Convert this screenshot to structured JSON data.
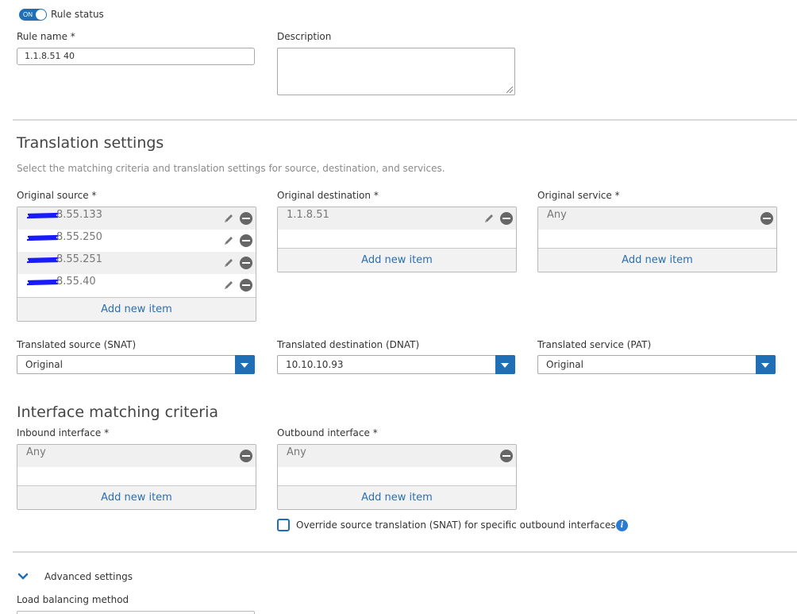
{
  "rule_status": {
    "toggle_text": "ON",
    "label": "Rule status"
  },
  "rule_name": {
    "label": "Rule name *",
    "value": "1.1.8.51 40"
  },
  "description": {
    "label": "Description",
    "value": ""
  },
  "translation": {
    "title": "Translation settings",
    "desc": "Select the matching criteria and translation settings for source, destination, and services.",
    "original_source": {
      "label": "Original source *",
      "items": [
        "8.55.133",
        "8.55.250",
        "8.55.251",
        "8.55.40"
      ],
      "add": "Add new item"
    },
    "original_destination": {
      "label": "Original destination *",
      "items": [
        "1.1.8.51"
      ],
      "add": "Add new item"
    },
    "original_service": {
      "label": "Original service *",
      "items": [
        "Any"
      ],
      "add": "Add new item"
    },
    "translated_source": {
      "label": "Translated source (SNAT)",
      "value": "Original"
    },
    "translated_destination": {
      "label": "Translated destination (DNAT)",
      "value": "10.10.10.93"
    },
    "translated_service": {
      "label": "Translated service (PAT)",
      "value": "Original"
    }
  },
  "interface": {
    "title": "Interface matching criteria",
    "inbound": {
      "label": "Inbound interface *",
      "items": [
        "Any"
      ],
      "add": "Add new item"
    },
    "outbound": {
      "label": "Outbound interface *",
      "items": [
        "Any"
      ],
      "add": "Add new item"
    },
    "override_label": "Override source translation (SNAT) for specific outbound interfaces"
  },
  "advanced": {
    "label": "Advanced settings"
  },
  "load_balancing": {
    "label": "Load balancing method"
  },
  "colors": {
    "accent": "#1e6fb5",
    "link": "#2a6fb0"
  },
  "icons": [
    "pencil-icon",
    "remove-icon",
    "dropdown-arrow-icon",
    "info-icon",
    "chevron-down-icon"
  ]
}
